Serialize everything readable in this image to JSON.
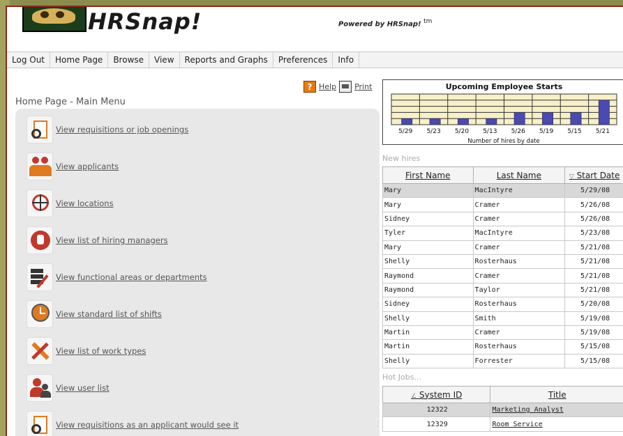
{
  "header": {
    "brand": "HRSnap!",
    "powered_by": "Powered by HRSnap!",
    "trademark": "tm"
  },
  "nav": [
    "Log Out",
    "Home Page",
    "Browse",
    "View",
    "Reports and Graphs",
    "Preferences",
    "Info"
  ],
  "toolbar": {
    "help_label": "Help",
    "print_label": "Print"
  },
  "page_title": "Home Page - Main Menu",
  "menu": [
    {
      "label": "View requisitions or job openings",
      "icon": "requisition-icon"
    },
    {
      "label": "View applicants",
      "icon": "applicants-icon"
    },
    {
      "label": "View locations",
      "icon": "globe-icon"
    },
    {
      "label": "View list of hiring managers",
      "icon": "manager-badge-icon"
    },
    {
      "label": "View functional areas or departments",
      "icon": "departments-icon"
    },
    {
      "label": "View standard list of shifts",
      "icon": "clock-icon"
    },
    {
      "label": "View list of work types",
      "icon": "tools-icon"
    },
    {
      "label": "View user list",
      "icon": "users-icon"
    },
    {
      "label": "View requisitions as an applicant would see it",
      "icon": "requisition-icon"
    }
  ],
  "chart_data": {
    "type": "bar",
    "title": "Upcoming Employee Starts",
    "xlabel": "Number of hires by date",
    "ylabel": "",
    "categories": [
      "5/29",
      "5/23",
      "5/20",
      "5/13",
      "5/26",
      "5/19",
      "5/15",
      "5/21"
    ],
    "values": [
      1,
      1,
      1,
      1,
      2,
      2,
      2,
      4
    ],
    "ylim": [
      0,
      5
    ],
    "grid": true,
    "colors": {
      "bar": "#4a4ab0",
      "grid": "#f7f0c8",
      "line": "#333333"
    }
  },
  "new_hires": {
    "section_label": "New hires",
    "columns": [
      "First Name",
      "Last Name",
      "Start Date"
    ],
    "sort_indicator": "▽",
    "rows": [
      [
        "Mary",
        "MacIntyre",
        "5/29/08"
      ],
      [
        "Mary",
        "Cramer",
        "5/26/08"
      ],
      [
        "Sidney",
        "Cramer",
        "5/26/08"
      ],
      [
        "Tyler",
        "MacIntyre",
        "5/23/08"
      ],
      [
        "Mary",
        "Cramer",
        "5/21/08"
      ],
      [
        "Shelly",
        "Rosterhaus",
        "5/21/08"
      ],
      [
        "Raymond",
        "Cramer",
        "5/21/08"
      ],
      [
        "Raymond",
        "Taylor",
        "5/21/08"
      ],
      [
        "Sidney",
        "Rosterhaus",
        "5/20/08"
      ],
      [
        "Shelly",
        "Smith",
        "5/19/08"
      ],
      [
        "Martin",
        "Cramer",
        "5/19/08"
      ],
      [
        "Martin",
        "Rosterhaus",
        "5/15/08"
      ],
      [
        "Shelly",
        "Forrester",
        "5/15/08"
      ]
    ]
  },
  "hot_jobs": {
    "section_label": "Hot Jobs...",
    "columns": [
      "System ID",
      "Title"
    ],
    "sort_indicator": "∠",
    "rows": [
      [
        "12322",
        "Marketing Analyst"
      ],
      [
        "12329",
        "Room Service"
      ]
    ]
  }
}
